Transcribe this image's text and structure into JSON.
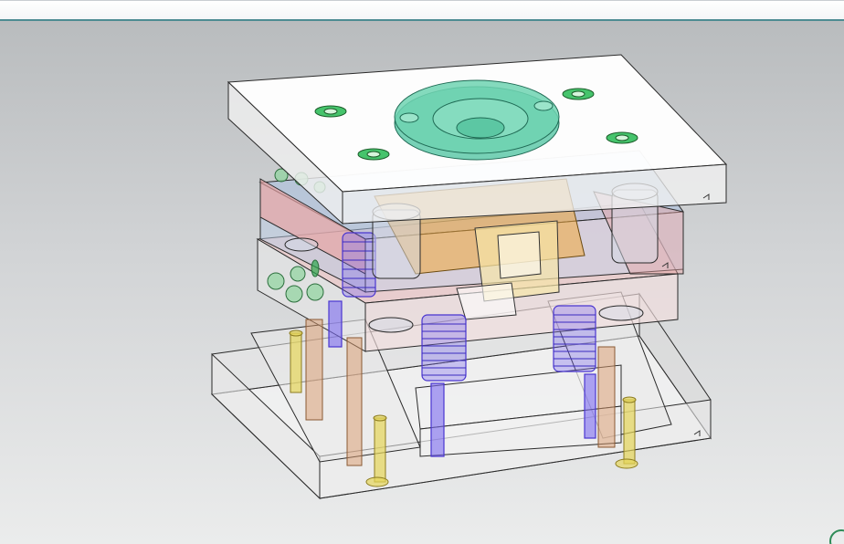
{
  "app": {
    "title": ""
  },
  "viewport": {
    "background": "#c8cacc",
    "model_name": "",
    "colors": {
      "plate_fill": "#f3f3f3",
      "edge": "#2a2a2a",
      "teal_ring": "#3fbf98",
      "green_bolt": "#3cc46a",
      "blue_plate": "#9fb6d8",
      "red_plate": "#e3a6a6",
      "orange_core": "#f2a93b",
      "spring": "#5b45e0",
      "yellow_pin": "#e6d65a",
      "copper": "#d99a6c"
    }
  }
}
